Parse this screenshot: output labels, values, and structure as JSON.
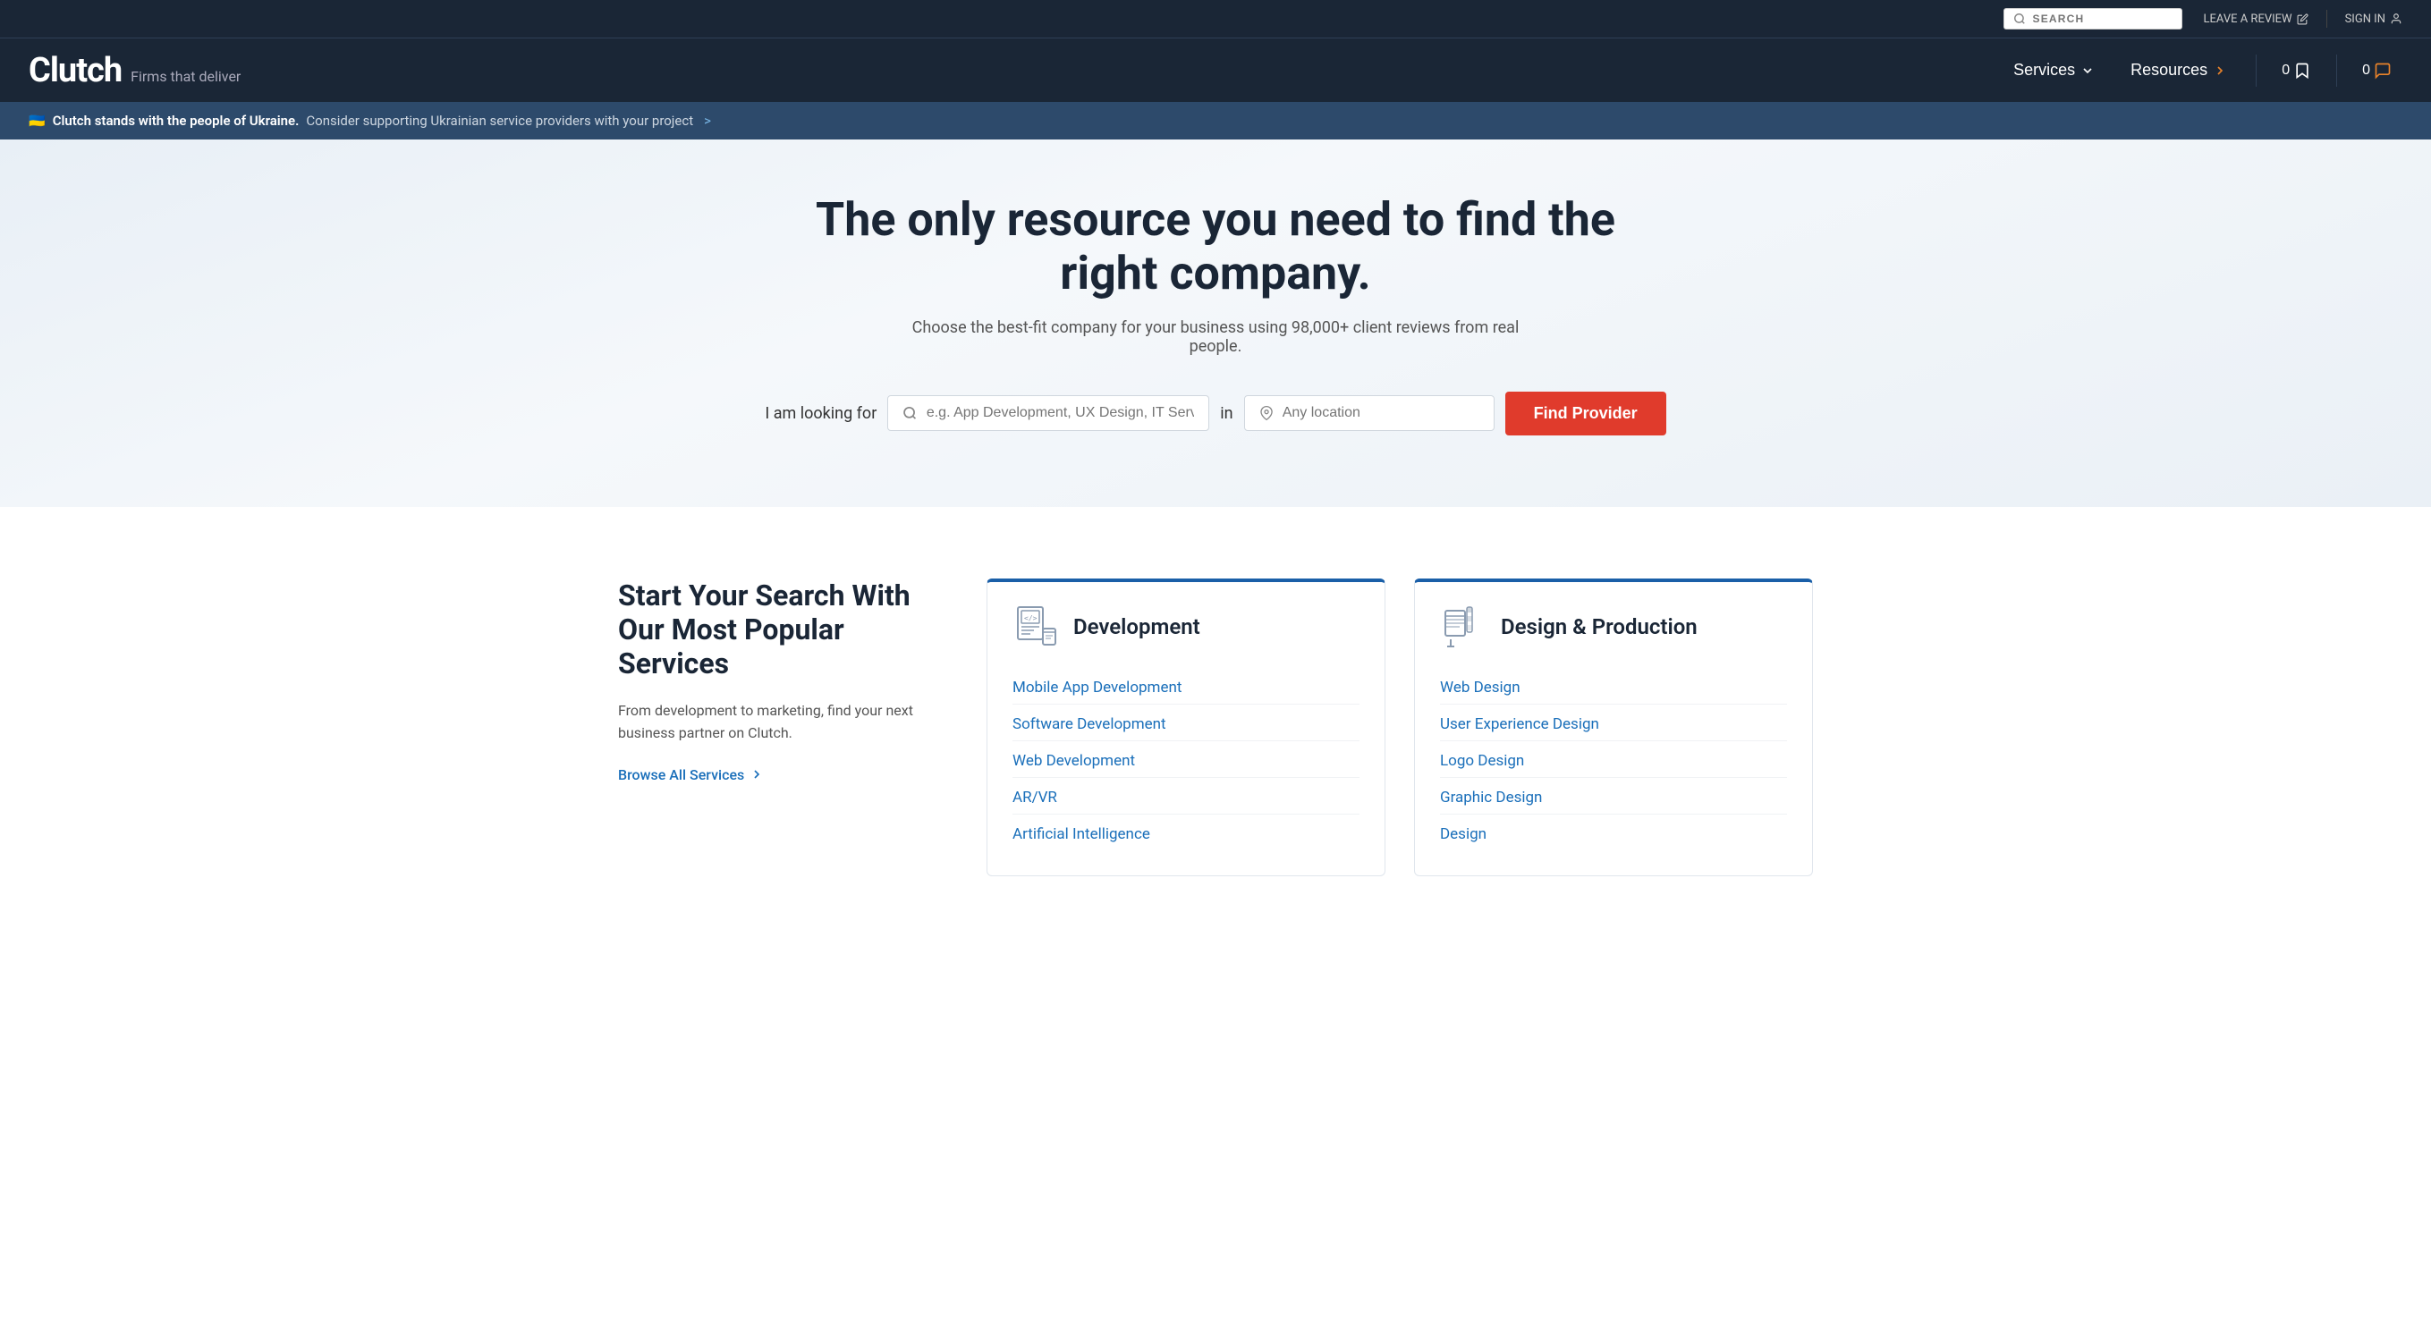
{
  "topBar": {
    "search_placeholder": "SEARCH",
    "leave_review": "LEAVE A REVIEW",
    "sign_in": "SIGN IN"
  },
  "mainNav": {
    "logo": "Clutch",
    "tagline": "Firms that deliver",
    "services_label": "Services",
    "resources_label": "Resources",
    "bookmarks_count": "0",
    "messages_count": "0"
  },
  "ukraineBanner": {
    "flag": "🇺🇦",
    "bold_text": "Clutch stands with the people of Ukraine.",
    "normal_text": "Consider supporting Ukrainian service providers with your project",
    "arrow": ">"
  },
  "hero": {
    "title": "The only resource you need to find the right company.",
    "subtitle": "Choose the best-fit company for your business using 98,000+ client reviews from real people.",
    "search_label": "I am looking for",
    "service_placeholder": "e.g. App Development, UX Design, IT Services...",
    "in_label": "in",
    "location_placeholder": "Any location",
    "find_button": "Find Provider"
  },
  "servicesSection": {
    "title": "Start Your Search With Our Most Popular Services",
    "description": "From development to marketing, find your next business partner on Clutch.",
    "browse_link": "Browse All Services",
    "development": {
      "title": "Development",
      "links": [
        "Mobile App Development",
        "Software Development",
        "Web Development",
        "AR/VR",
        "Artificial Intelligence"
      ]
    },
    "design": {
      "title": "Design & Production",
      "links": [
        "Web Design",
        "User Experience Design",
        "Logo Design",
        "Graphic Design",
        "Design"
      ]
    }
  }
}
